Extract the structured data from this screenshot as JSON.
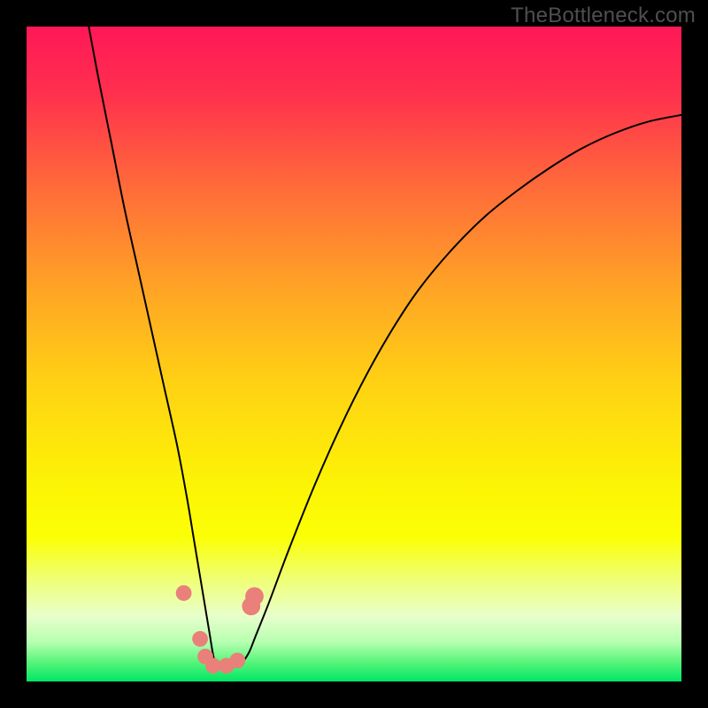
{
  "watermark": "TheBottleneck.com",
  "chart_data": {
    "type": "line",
    "title": "",
    "xlabel": "",
    "ylabel": "",
    "xlim": [
      0,
      100
    ],
    "ylim": [
      0,
      100
    ],
    "grid": false,
    "legend": false,
    "background_gradient": {
      "stops": [
        {
          "offset": 0.0,
          "color": "#ff1857"
        },
        {
          "offset": 0.1,
          "color": "#ff2f4e"
        },
        {
          "offset": 0.25,
          "color": "#ff6d39"
        },
        {
          "offset": 0.4,
          "color": "#ffa425"
        },
        {
          "offset": 0.55,
          "color": "#ffd313"
        },
        {
          "offset": 0.7,
          "color": "#fcf405"
        },
        {
          "offset": 0.78,
          "color": "#fbff05"
        },
        {
          "offset": 0.84,
          "color": "#f0ff6f"
        },
        {
          "offset": 0.9,
          "color": "#e8ffcb"
        },
        {
          "offset": 0.94,
          "color": "#b6ffb0"
        },
        {
          "offset": 0.97,
          "color": "#59f57b"
        },
        {
          "offset": 1.0,
          "color": "#00e765"
        }
      ]
    },
    "series": [
      {
        "name": "bottleneck-curve",
        "color": "#000000",
        "x": [
          9.5,
          11,
          13,
          15,
          17,
          19,
          21,
          23,
          24.5,
          25.5,
          26.5,
          27.5,
          28.0,
          28.5,
          29.0,
          30.0,
          31.0,
          32.0,
          33.0,
          34.0,
          35.0,
          37.0,
          40.0,
          44.0,
          48.0,
          52.0,
          56.0,
          60.0,
          65.0,
          70.0,
          75.0,
          80.0,
          85.0,
          90.0,
          95.0,
          100.0
        ],
        "y": [
          100,
          92,
          82,
          72,
          63,
          54,
          45,
          36,
          28,
          22,
          16,
          10,
          7,
          4,
          2.3,
          2.2,
          2.2,
          2.3,
          3.0,
          4.5,
          7.0,
          12,
          20,
          30,
          39,
          47,
          54,
          60,
          66,
          71,
          75,
          78.5,
          81.5,
          83.8,
          85.5,
          86.5
        ]
      }
    ],
    "markers": [
      {
        "x": 24.0,
        "y": 13.5,
        "r": 1.2,
        "color": "#e98079"
      },
      {
        "x": 26.5,
        "y": 6.5,
        "r": 1.2,
        "color": "#e98079"
      },
      {
        "x": 27.3,
        "y": 3.8,
        "r": 1.2,
        "color": "#e98079"
      },
      {
        "x": 28.5,
        "y": 2.4,
        "r": 1.2,
        "color": "#e98079"
      },
      {
        "x": 30.5,
        "y": 2.4,
        "r": 1.2,
        "color": "#e98079"
      },
      {
        "x": 32.2,
        "y": 3.2,
        "r": 1.2,
        "color": "#e98079"
      },
      {
        "x": 34.3,
        "y": 11.5,
        "r": 1.4,
        "color": "#e98079"
      },
      {
        "x": 34.8,
        "y": 13.0,
        "r": 1.4,
        "color": "#e98079"
      }
    ]
  }
}
